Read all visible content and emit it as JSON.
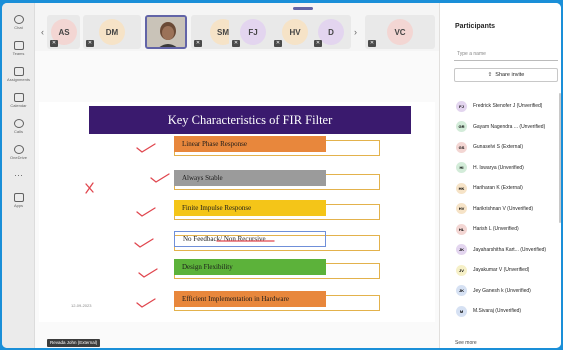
{
  "rail": {
    "items": [
      {
        "label": "Chat",
        "icon": "chat-icon"
      },
      {
        "label": "Teams",
        "icon": "teams-icon"
      },
      {
        "label": "Assignments",
        "icon": "assignments-icon"
      },
      {
        "label": "Calendar",
        "icon": "calendar-icon"
      },
      {
        "label": "Calls",
        "icon": "calls-icon"
      },
      {
        "label": "OneDrive",
        "icon": "onedrive-icon"
      },
      {
        "label": "",
        "icon": "more-icon"
      },
      {
        "label": "Apps",
        "icon": "apps-icon"
      }
    ]
  },
  "gallery": {
    "tiles": [
      {
        "initials": "AS",
        "color": "#f3d6d3"
      },
      {
        "initials": "DM",
        "color": "#f6e3c7"
      },
      {
        "initials": "",
        "color": "#b7b0a7",
        "video": true
      },
      {
        "initials": "SM",
        "color": "#f6e3c7"
      },
      {
        "initials": "FJ",
        "color": "#e3d5ef"
      },
      {
        "initials": "HV",
        "color": "#f6e3c7"
      },
      {
        "initials": "D",
        "color": "#e3d5ef"
      },
      {
        "initials": "VC",
        "color": "#f3d6d3"
      }
    ],
    "prev_icon": "chevron-left-icon",
    "next_icon": "chevron-right-icon"
  },
  "slide": {
    "title": "Key Characteristics of FIR Filter",
    "date": "12-09-2023",
    "items": [
      {
        "label": "Linear Phase Response",
        "color": "#e8873c",
        "mark": "check"
      },
      {
        "label": "Always Stable",
        "color": "#9b9b9b",
        "mark": "check"
      },
      {
        "label": "Finite Impulse Response",
        "color": "#f4c518",
        "mark": "check"
      },
      {
        "label": "No Feedback/ Non Recursive",
        "color": "#6f8fd9",
        "mark": "check"
      },
      {
        "label": "Design Flexibility",
        "color": "#5cb23a",
        "mark": "check"
      },
      {
        "label": "Efficient Implementation in Hardware",
        "color": "#e8873c",
        "mark": "check"
      }
    ],
    "cross_mark": "x"
  },
  "speaker_name": "Revada John (External)",
  "panel": {
    "title": "Participants",
    "search_placeholder": "Type a name",
    "share_invite": "Share invite",
    "see_more": "See more",
    "participants": [
      {
        "initials": "FJ",
        "name": "Fredrick Stenofer J (Unverified)",
        "color": "#e3d5ef"
      },
      {
        "initials": "GR",
        "name": "Gayam Nagendra ... (Unverified)",
        "color": "#d3ecd9"
      },
      {
        "initials": "GS",
        "name": "Gunaselvi S (External)",
        "color": "#f3d6d3"
      },
      {
        "initials": "HI",
        "name": "H. Iswarya (Unverified)",
        "color": "#d3ecd9"
      },
      {
        "initials": "HK",
        "name": "Hariharan K (External)",
        "color": "#f6e3c7"
      },
      {
        "initials": "HV",
        "name": "Harikrishnan V (Unverified)",
        "color": "#f6e3c7"
      },
      {
        "initials": "HL",
        "name": "Harish L (Unverified)",
        "color": "#f3d6d3"
      },
      {
        "initials": "JK",
        "name": "Jayaharshitha Kart... (Unverified)",
        "color": "#e3d5ef"
      },
      {
        "initials": "JV",
        "name": "Jayakumar V (Unverified)",
        "color": "#f6f0c7"
      },
      {
        "initials": "JK",
        "name": "Jey Ganesh k (Unverified)",
        "color": "#d6e1f3"
      },
      {
        "initials": "M",
        "name": "M.Sivaraj (Unverified)",
        "color": "#d6e1f3"
      }
    ]
  }
}
